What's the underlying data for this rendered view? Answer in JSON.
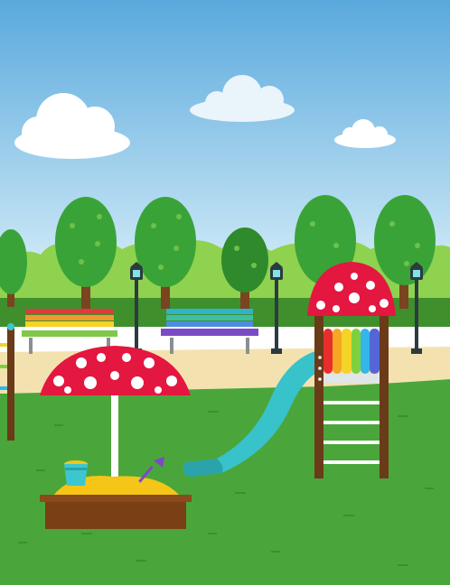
{
  "scene": {
    "description_tag": "",
    "colors": {
      "sky_top": "#5aa9dd",
      "sky_bottom": "#cfeaf7",
      "cloud": "#ffffff",
      "cloud_shade": "#e6f2fb",
      "hedge_light": "#8fd24f",
      "hedge_dark": "#3f8f2d",
      "tree_canopy": "#3aa338",
      "tree_canopy_light": "#6cc24a",
      "tree_trunk": "#7a4420",
      "path": "#f3e2b0",
      "grass": "#4aa63a",
      "grass_dark": "#3d8f2f",
      "mushroom_red": "#e3173f",
      "mushroom_dot": "#ffffff",
      "wood": "#6b3a18",
      "slide": "#38c2c9",
      "slide_dark": "#2aa3aa",
      "sand": "#f5c518",
      "sandbox_wood": "#7a3f14",
      "bucket": "#3cc7d0",
      "shovel": "#7a4bc4",
      "lamp_post": "#2b3b3f",
      "lamp_light": "#7fe3e8",
      "bench_left_rails": [
        "#e03a3a",
        "#f09a2b",
        "#f5d327",
        "#7fc84a"
      ],
      "bench_right_rails": [
        "#2fb3c8",
        "#3cc0a0",
        "#4f8be0",
        "#7a4bc4"
      ],
      "rainbow_pipes": [
        "#e82d2d",
        "#f5a623",
        "#f5d327",
        "#7fd03e",
        "#33b6e8",
        "#5466d6"
      ]
    },
    "icons": [
      "cloud-icon",
      "tree-icon",
      "lamp-icon",
      "bench-icon",
      "slide-icon",
      "sandbox-icon",
      "bucket-icon",
      "shovel-icon",
      "umbrella-icon"
    ]
  }
}
